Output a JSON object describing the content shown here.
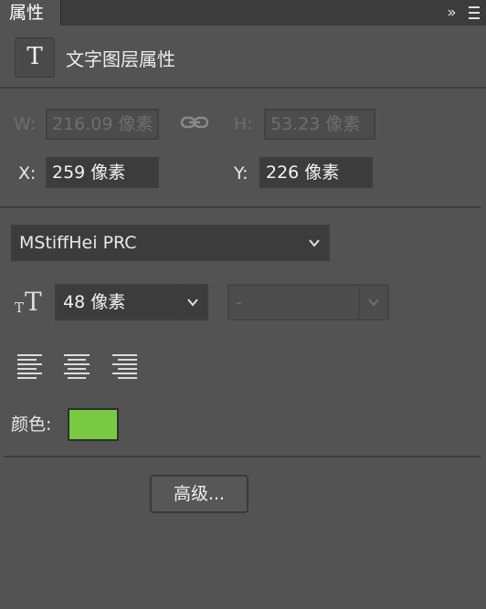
{
  "panel": {
    "tab_label": "属性",
    "collapse_label": "»",
    "collapse_icon": "double-chevron-right-icon",
    "menu_icon": "hamburger-menu-icon"
  },
  "header": {
    "icon_glyph": "T",
    "icon_name": "type-layer-icon",
    "title": "文字图层属性"
  },
  "transform": {
    "w_label": "W:",
    "w_value": "216.09 像素",
    "h_label": "H:",
    "h_value": "53.23 像素",
    "link_icon": "chain-link-icon",
    "x_label": "X:",
    "x_value": "259 像素",
    "y_label": "Y:",
    "y_value": "226 像素"
  },
  "font": {
    "family": "MStiffHei PRC",
    "size_icon": "font-size-icon",
    "size": "48 像素",
    "style": "-"
  },
  "alignment": {
    "icons": [
      "align-left-icon",
      "align-center-icon",
      "align-right-icon"
    ]
  },
  "color": {
    "label": "颜色:",
    "value": "#7ac943"
  },
  "advanced_button": "高级..."
}
